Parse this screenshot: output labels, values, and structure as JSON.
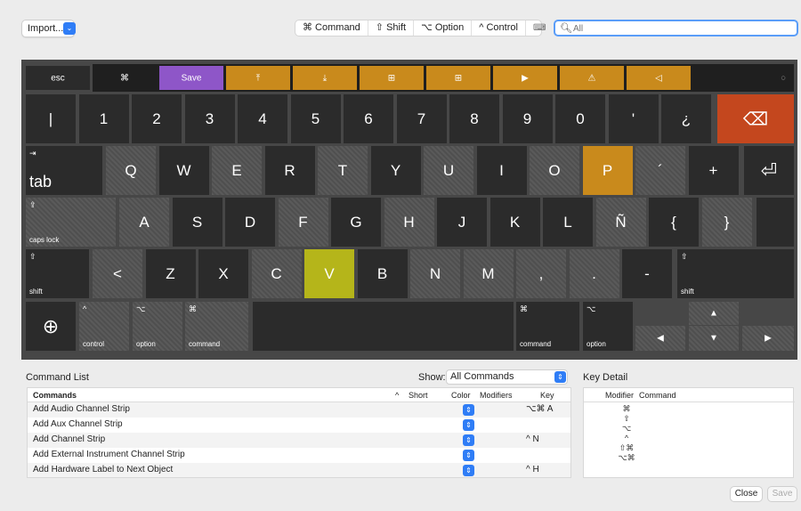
{
  "toolbar": {
    "import_label": "Import...",
    "modifiers": [
      "⌘ Command",
      "⇧ Shift",
      "⌥ Option",
      "^ Control"
    ],
    "keyboard_icon": "⌨",
    "search_placeholder": "All"
  },
  "keyboard": {
    "function_row": [
      {
        "label": "esc",
        "color": "#2b2b2b"
      },
      {
        "label": "⌘",
        "color": "#2b2b2b"
      },
      {
        "label": "Save",
        "color": "#8e56c8"
      },
      {
        "label": "⤒",
        "color": "#c98a1c"
      },
      {
        "label": "⤓",
        "color": "#c98a1c"
      },
      {
        "label": "⊞",
        "color": "#c98a1c"
      },
      {
        "label": "⊞",
        "color": "#c98a1c"
      },
      {
        "label": "▶",
        "color": "#c98a1c"
      },
      {
        "label": "⚠",
        "color": "#c98a1c"
      },
      {
        "label": "◁",
        "color": "#c98a1c"
      },
      {
        "label": "○",
        "color": "#2b2b2b"
      }
    ],
    "number_row": [
      "|",
      "1",
      "2",
      "3",
      "4",
      "5",
      "6",
      "7",
      "8",
      "9",
      "0",
      "'",
      "¿",
      "⌫"
    ],
    "qwerty_row": [
      "tab",
      "Q",
      "W",
      "E",
      "R",
      "T",
      "Y",
      "U",
      "I",
      "O",
      "P",
      "´",
      "+",
      "⏎"
    ],
    "tab_icon": "⇥",
    "home_row": [
      "caps lock",
      "A",
      "S",
      "D",
      "F",
      "G",
      "H",
      "J",
      "K",
      "L",
      "Ñ",
      "{",
      "}"
    ],
    "caps_icon": "⇪",
    "shift_row": [
      "shift",
      "<",
      "Z",
      "X",
      "C",
      "V",
      "B",
      "N",
      "M",
      ",",
      ".",
      "-",
      "shift"
    ],
    "shift_icon": "⇧",
    "bottom_row": {
      "globe": "⊕",
      "control": "control",
      "control_symbol": "^",
      "option": "option",
      "option_symbol": "⌥",
      "command": "command",
      "command_symbol": "⌘",
      "arrows": [
        "◀",
        "▲",
        "▼",
        "▶"
      ]
    },
    "highlight_colors": {
      "save": "#8e56c8",
      "orange": "#c98a1c",
      "delete": "#c4471e",
      "v_key": "#b5b51a",
      "p_key": "#c98a1c"
    }
  },
  "command_list": {
    "title": "Command List",
    "show_label": "Show:",
    "show_value": "All Commands",
    "headers": {
      "commands": "Commands",
      "short": "Short",
      "color": "Color",
      "modifiers": "Modifiers",
      "key": "Key"
    },
    "rows": [
      {
        "name": "Add Audio Channel Strip",
        "mods": "⌥⌘",
        "key": "A"
      },
      {
        "name": "Add Aux Channel Strip",
        "mods": "",
        "key": ""
      },
      {
        "name": "Add Channel Strip",
        "mods": "^",
        "key": "N"
      },
      {
        "name": "Add External Instrument Channel Strip",
        "mods": "",
        "key": ""
      },
      {
        "name": "Add Hardware Label to Next Object",
        "mods": "^",
        "key": "H"
      }
    ]
  },
  "key_detail": {
    "title": "Key Detail",
    "headers": {
      "modifier": "Modifier",
      "command": "Command"
    },
    "modifiers": [
      "⌘",
      "⇧",
      "⌥",
      "^",
      "⇧⌘",
      "⌥⌘"
    ]
  },
  "footer": {
    "close_label": "Close",
    "save_label": "Save"
  }
}
